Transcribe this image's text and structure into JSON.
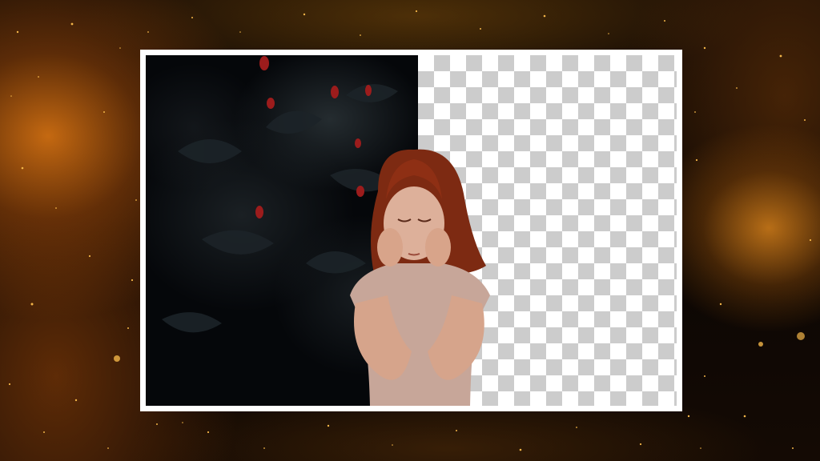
{
  "scene": {
    "description_hidden": "",
    "colors": {
      "background_glow": "#c86e12",
      "frame": "#ffffff",
      "checker_light": "#ffffff",
      "checker_dark": "#cccccc",
      "hair": "#8e2f14",
      "dress": "#c9a89c",
      "skin": "#d8a58c"
    },
    "icons": [
      "sparkle-particles",
      "leaf-shapes",
      "red-flower-buds",
      "girl-portrait"
    ]
  }
}
